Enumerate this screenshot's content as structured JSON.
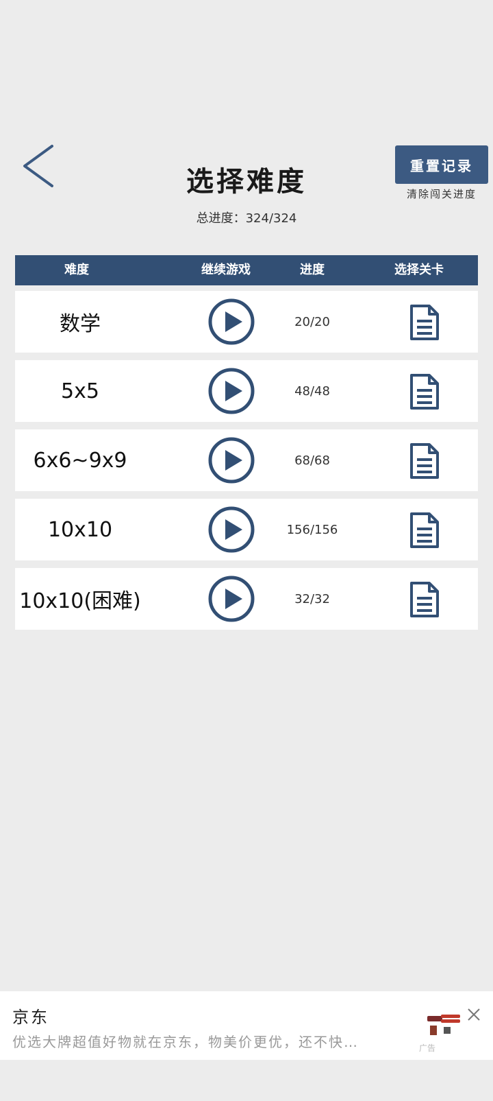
{
  "header": {
    "title": "选择难度",
    "total_progress": "总进度：324/324",
    "reset_button": "重置记录",
    "reset_hint": "清除闯关进度"
  },
  "table": {
    "columns": [
      "难度",
      "继续游戏",
      "进度",
      "选择关卡"
    ],
    "rows": [
      {
        "name": "数学",
        "progress": "20/20"
      },
      {
        "name": "5x5",
        "progress": "48/48"
      },
      {
        "name": "6x6~9x9",
        "progress": "68/68"
      },
      {
        "name": "10x10",
        "progress": "156/156"
      },
      {
        "name": "10x10(困难)",
        "progress": "32/32"
      }
    ]
  },
  "ad": {
    "title": "京东",
    "text": "优选大牌超值好物就在京东，物美价更优，还不快…",
    "label": "广告"
  },
  "icons": {
    "back": "chevron-left-icon",
    "play": "play-circle-icon",
    "levels": "document-list-icon",
    "close": "close-icon"
  },
  "colors": {
    "accent": "#324f74",
    "background": "#ececec"
  }
}
